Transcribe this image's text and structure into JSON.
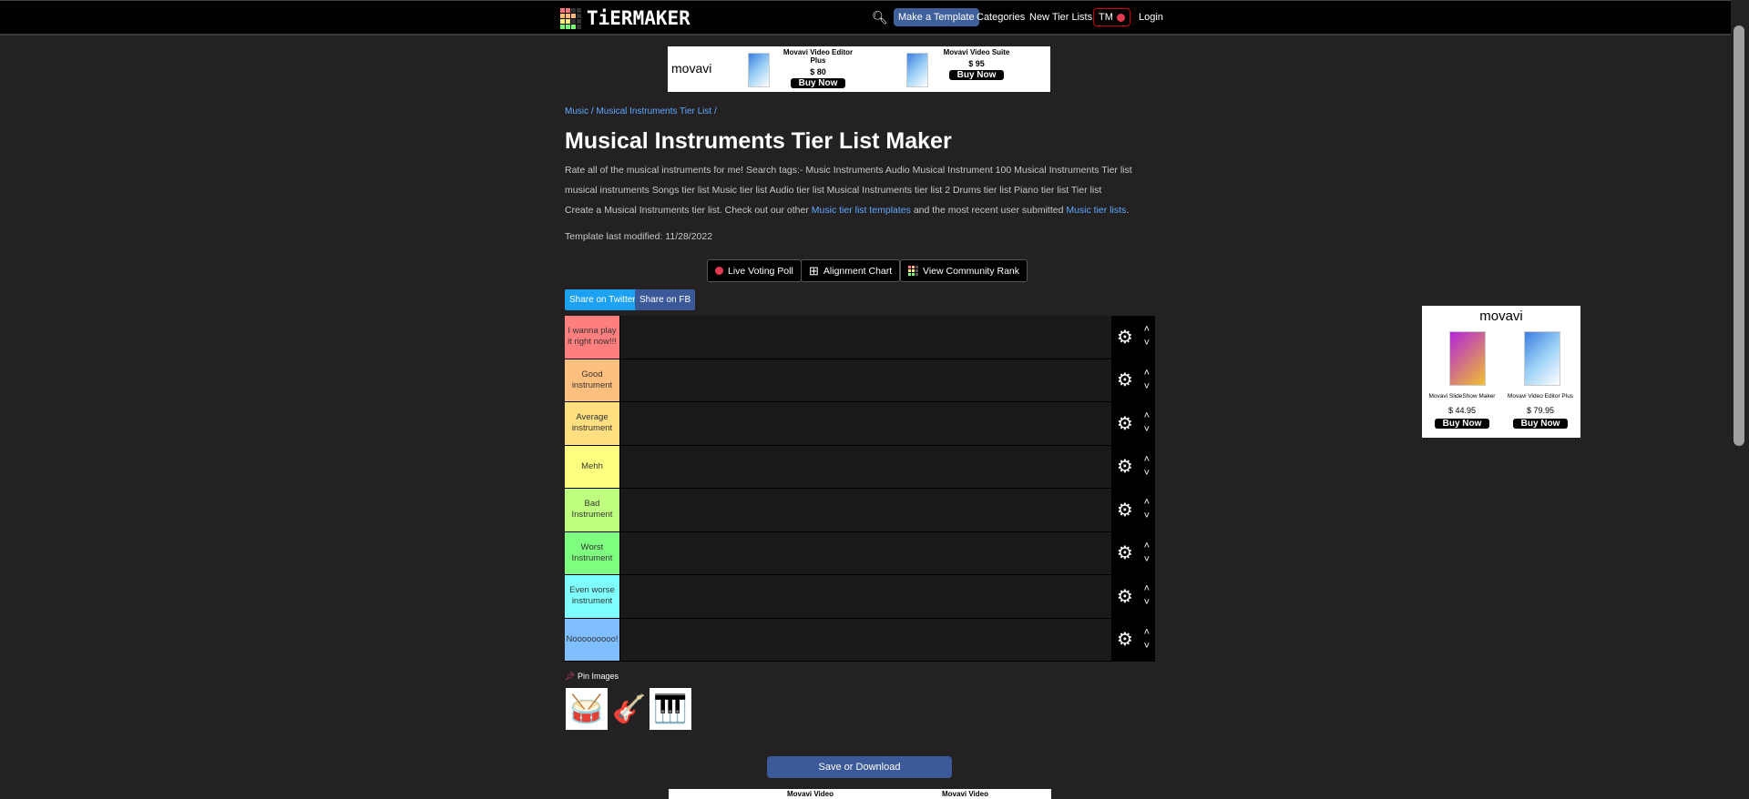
{
  "nav": {
    "logo": "TiERMAKER",
    "make_template": "Make a Template",
    "categories": "Categories",
    "new_tier_lists": "New Tier Lists",
    "tm": "TM",
    "login": "Login"
  },
  "top_ad": {
    "brand": "movavi",
    "products": [
      {
        "name": "Movavi Video Editor Plus",
        "price": "$ 80",
        "cta": "Buy Now"
      },
      {
        "name": "Movavi Video Suite",
        "price": "$ 95",
        "cta": "Buy Now"
      }
    ]
  },
  "side_ad": {
    "brand": "movavi",
    "products": [
      {
        "name": "Movavi SlideShow Maker",
        "price": "$ 44.95",
        "cta": "Buy Now"
      },
      {
        "name": "Movavi Video Editor Plus",
        "price": "$ 79.95",
        "cta": "Buy Now"
      }
    ]
  },
  "bottom_ad": {
    "products": [
      {
        "name": "Movavi Video"
      },
      {
        "name": "Movavi Video"
      }
    ]
  },
  "breadcrumb": {
    "music": "Music",
    "sep1": " / ",
    "list": "Musical Instruments Tier List",
    "sep2": " /"
  },
  "title": "Musical Instruments Tier List Maker",
  "description": "Rate all of the musical instruments for me! Search tags:- Music Instruments Audio Musical Instrument 100 Musical Instruments Tier list musical instruments Songs tier list Music tier list Audio tier list Musical Instruments tier list 2 Drums tier list Piano tier list Tier list",
  "create": {
    "pre": "Create a Musical Instruments tier list. Check out our other ",
    "link1": "Music tier list templates",
    "mid": " and the most recent user submitted ",
    "link2": "Music tier lists",
    "post": "."
  },
  "modified": "Template last modified: 11/28/2022",
  "actions": {
    "poll": "Live Voting Poll",
    "alignment": "Alignment Chart",
    "community": "View Community Rank"
  },
  "share": {
    "twitter": "Share on Twitter",
    "fb": "Share on FB"
  },
  "tiers": [
    {
      "label": "I wanna play it right now!!!",
      "color": "#ff7f7f"
    },
    {
      "label": "Good instrument",
      "color": "#ffbf7f"
    },
    {
      "label": "Average instrument",
      "color": "#ffdf7f"
    },
    {
      "label": "Mehh",
      "color": "#ffff7f"
    },
    {
      "label": "Bad Instrument",
      "color": "#bfff7f"
    },
    {
      "label": "Worst Instrument",
      "color": "#7fff7f"
    },
    {
      "label": "Even worse instrument",
      "color": "#7fffff"
    },
    {
      "label": "Nooooooooo!",
      "color": "#7fbfff"
    }
  ],
  "pin_label": "Pin Images",
  "images": [
    "drums",
    "guitar",
    "piano"
  ],
  "save": "Save or Download"
}
